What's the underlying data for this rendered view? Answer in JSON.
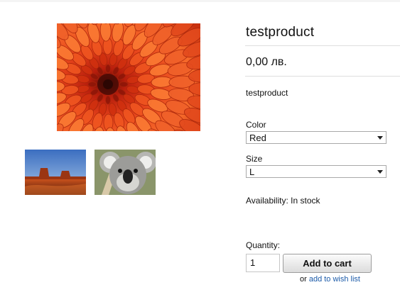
{
  "product": {
    "title": "testproduct",
    "price": "0,00 лв.",
    "short_description": "testproduct"
  },
  "images": {
    "main": "flower-image",
    "thumbnails": [
      "desert-mesa-thumbnail",
      "koala-thumbnail"
    ]
  },
  "options": {
    "color": {
      "label": "Color",
      "selected": "Red"
    },
    "size": {
      "label": "Size",
      "selected": "L"
    }
  },
  "availability": "Availability: In stock",
  "purchase": {
    "quantity_label": "Quantity:",
    "quantity_value": "1",
    "add_to_cart_label": "Add to cart",
    "or_text": "or",
    "wishlist_label": "add to wish list"
  },
  "colors": {
    "link": "#1b5aa8",
    "flower": "#e8431d",
    "text": "#111111"
  }
}
